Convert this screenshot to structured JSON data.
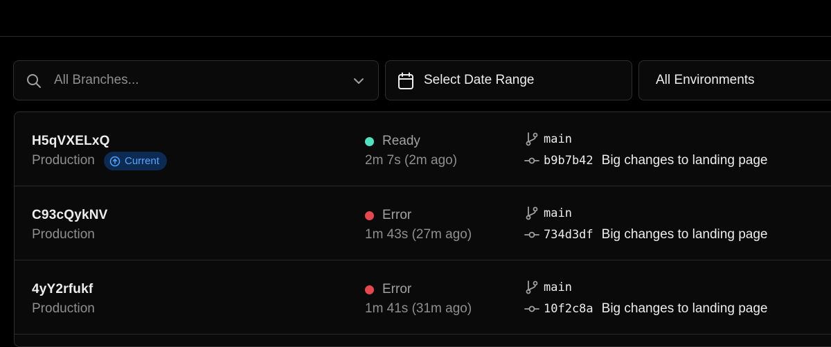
{
  "filters": {
    "branch_placeholder": "All Branches...",
    "date_label": "Select Date Range",
    "environment_label": "All Environments"
  },
  "colors": {
    "ready": "#50e3c2",
    "error": "#e5484d",
    "current_badge_bg": "#0d2a52",
    "current_badge_text": "#52a8ff"
  },
  "deployments": [
    {
      "id": "H5qVXELxQ",
      "environment": "Production",
      "badge": "Current",
      "status": "Ready",
      "status_color": "ready",
      "duration": "2m 7s (2m ago)",
      "branch": "main",
      "commit_hash": "b9b7b42",
      "commit_message": "Big changes to landing page"
    },
    {
      "id": "C93cQykNV",
      "environment": "Production",
      "status": "Error",
      "status_color": "error",
      "duration": "1m 43s (27m ago)",
      "branch": "main",
      "commit_hash": "734d3df",
      "commit_message": "Big changes to landing page"
    },
    {
      "id": "4yY2rfukf",
      "environment": "Production",
      "status": "Error",
      "status_color": "error",
      "duration": "1m 41s (31m ago)",
      "branch": "main",
      "commit_hash": "10f2c8a",
      "commit_message": "Big changes to landing page"
    }
  ]
}
